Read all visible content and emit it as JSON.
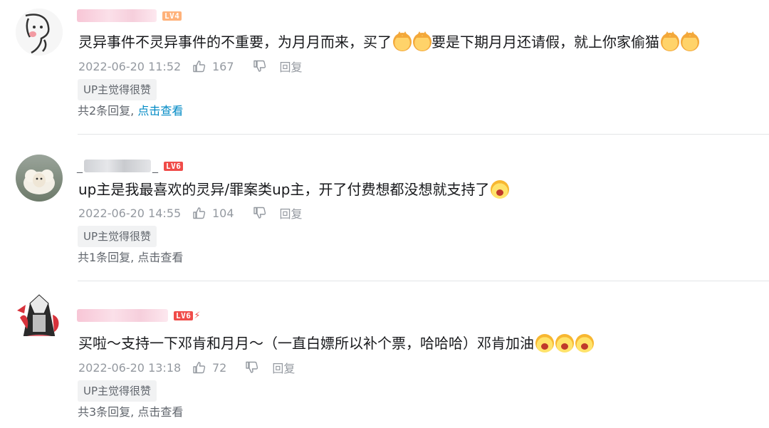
{
  "comments": [
    {
      "level_label": "LV4",
      "text": "灵异事件不灵异事件的不重要，为月月而来，买了",
      "text_mid": "要是下期月月还请假，就上你家偷猫",
      "time": "2022-06-20 11:52",
      "likes": "167",
      "reply_label": "回复",
      "badge": "UP主觉得很赞",
      "replies_count_text": "共2条回复,",
      "replies_link_text": "点击查看"
    },
    {
      "level_label": "LV6",
      "text": "up主是我最喜欢的灵异/罪案类up主，开了付费想都没想就支持了",
      "time": "2022-06-20 14:55",
      "likes": "104",
      "reply_label": "回复",
      "badge": "UP主觉得很赞",
      "replies_count_text": "共1条回复,",
      "replies_link_text": "点击查看"
    },
    {
      "level_label": "LV6",
      "level_suffix": "⚡",
      "text": "买啦～支持一下邓肯和月月～（一直白嫖所以补个票，哈哈哈）邓肯加油",
      "time": "2022-06-20 13:18",
      "likes": "72",
      "reply_label": "回复",
      "badge": "UP主觉得很赞",
      "replies_count_text": "共3条回复,",
      "replies_link_text": "点击查看"
    }
  ],
  "colors": {
    "link": "#008ac5",
    "meta": "#9499a0",
    "badge_bg": "#f1f2f3"
  },
  "icons": {
    "like": "thumb-up-icon",
    "dislike": "thumb-down-icon"
  }
}
